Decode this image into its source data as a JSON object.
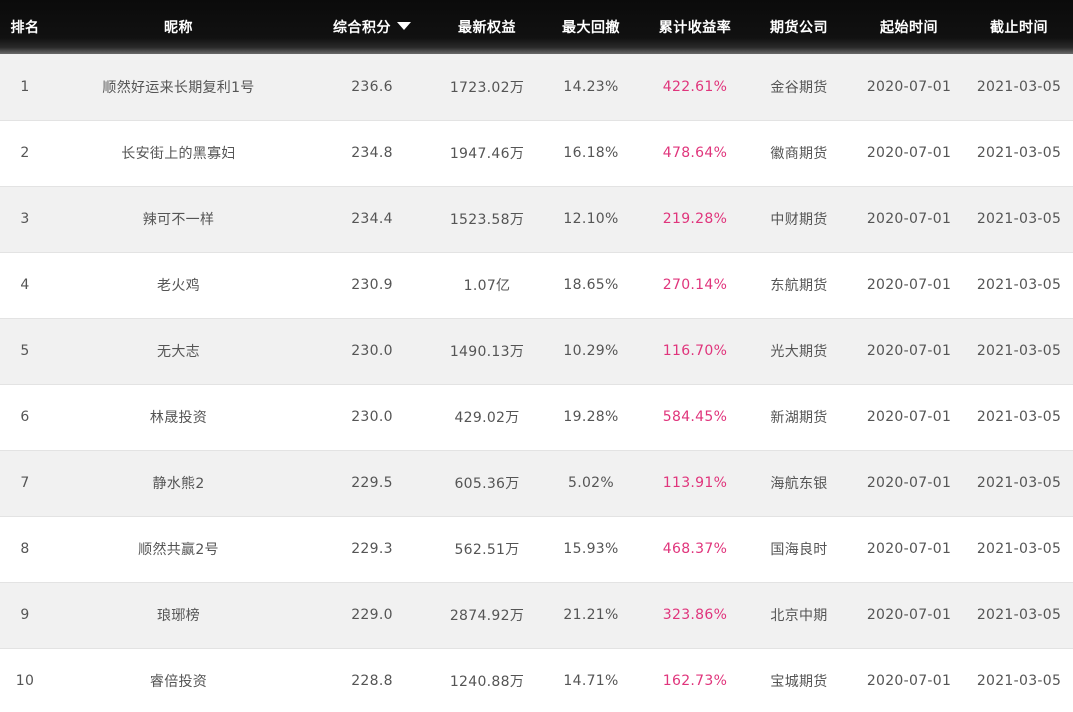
{
  "header": {
    "rank": "排名",
    "nickname": "昵称",
    "score": "综合积分",
    "equity": "最新权益",
    "drawdown": "最大回撤",
    "return": "累计收益率",
    "company": "期货公司",
    "start": "起始时间",
    "end": "截止时间"
  },
  "colors": {
    "header_bg": "#111111",
    "return_text": "#e0357c",
    "row_alt": "#f1f1f1"
  },
  "rows": [
    {
      "rank": "1",
      "nickname": "顺然好运来长期复利1号",
      "score": "236.6",
      "equity": "1723.02万",
      "drawdown": "14.23%",
      "return": "422.61%",
      "company": "金谷期货",
      "start": "2020-07-01",
      "end": "2021-03-05"
    },
    {
      "rank": "2",
      "nickname": "长安街上的黑寡妇",
      "score": "234.8",
      "equity": "1947.46万",
      "drawdown": "16.18%",
      "return": "478.64%",
      "company": "徽商期货",
      "start": "2020-07-01",
      "end": "2021-03-05"
    },
    {
      "rank": "3",
      "nickname": "辣可不一样",
      "score": "234.4",
      "equity": "1523.58万",
      "drawdown": "12.10%",
      "return": "219.28%",
      "company": "中财期货",
      "start": "2020-07-01",
      "end": "2021-03-05"
    },
    {
      "rank": "4",
      "nickname": "老火鸡",
      "score": "230.9",
      "equity": "1.07亿",
      "drawdown": "18.65%",
      "return": "270.14%",
      "company": "东航期货",
      "start": "2020-07-01",
      "end": "2021-03-05"
    },
    {
      "rank": "5",
      "nickname": "无大志",
      "score": "230.0",
      "equity": "1490.13万",
      "drawdown": "10.29%",
      "return": "116.70%",
      "company": "光大期货",
      "start": "2020-07-01",
      "end": "2021-03-05"
    },
    {
      "rank": "6",
      "nickname": "林晟投资",
      "score": "230.0",
      "equity": "429.02万",
      "drawdown": "19.28%",
      "return": "584.45%",
      "company": "新湖期货",
      "start": "2020-07-01",
      "end": "2021-03-05"
    },
    {
      "rank": "7",
      "nickname": "静水熊2",
      "score": "229.5",
      "equity": "605.36万",
      "drawdown": "5.02%",
      "return": "113.91%",
      "company": "海航东银",
      "start": "2020-07-01",
      "end": "2021-03-05"
    },
    {
      "rank": "8",
      "nickname": "顺然共赢2号",
      "score": "229.3",
      "equity": "562.51万",
      "drawdown": "15.93%",
      "return": "468.37%",
      "company": "国海良时",
      "start": "2020-07-01",
      "end": "2021-03-05"
    },
    {
      "rank": "9",
      "nickname": "琅琊榜",
      "score": "229.0",
      "equity": "2874.92万",
      "drawdown": "21.21%",
      "return": "323.86%",
      "company": "北京中期",
      "start": "2020-07-01",
      "end": "2021-03-05"
    },
    {
      "rank": "10",
      "nickname": "睿倍投资",
      "score": "228.8",
      "equity": "1240.88万",
      "drawdown": "14.71%",
      "return": "162.73%",
      "company": "宝城期货",
      "start": "2020-07-01",
      "end": "2021-03-05"
    }
  ]
}
